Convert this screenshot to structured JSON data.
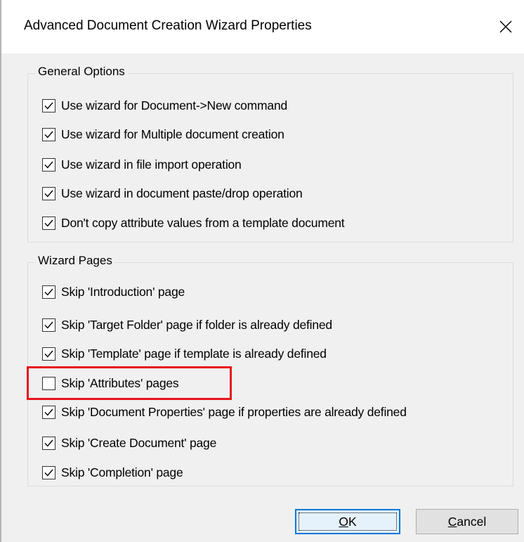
{
  "window": {
    "title": "Advanced Document Creation Wizard Properties",
    "close_icon": "close-icon"
  },
  "general_options": {
    "title": "General Options",
    "items": [
      {
        "label": "Use wizard for Document->New command",
        "checked": true
      },
      {
        "label": "Use wizard for Multiple document creation",
        "checked": true
      },
      {
        "label": "Use wizard in file import operation",
        "checked": true
      },
      {
        "label": "Use wizard in document paste/drop operation",
        "checked": true
      },
      {
        "label": "Don't copy attribute values from a template document",
        "checked": true
      }
    ]
  },
  "wizard_pages": {
    "title": "Wizard Pages",
    "items": [
      {
        "label": "Skip 'Introduction' page",
        "checked": true
      },
      {
        "label": "Skip 'Target Folder' page if folder is already defined",
        "checked": true
      },
      {
        "label": "Skip 'Template' page if template is already defined",
        "checked": true
      },
      {
        "label": "Skip 'Attributes' pages",
        "checked": false,
        "highlighted": true
      },
      {
        "label": "Skip 'Document Properties' page if properties are already defined",
        "checked": true
      },
      {
        "label": "Skip 'Create Document' page",
        "checked": true
      },
      {
        "label": "Skip 'Completion' page",
        "checked": true
      }
    ]
  },
  "buttons": {
    "ok_accel": "O",
    "ok_rest": "K",
    "cancel_accel": "C",
    "cancel_rest": "ancel"
  },
  "colors": {
    "highlight_border": "#e8141c",
    "default_button_border": "#0078d7",
    "dialog_background": "#f0f0f0"
  }
}
